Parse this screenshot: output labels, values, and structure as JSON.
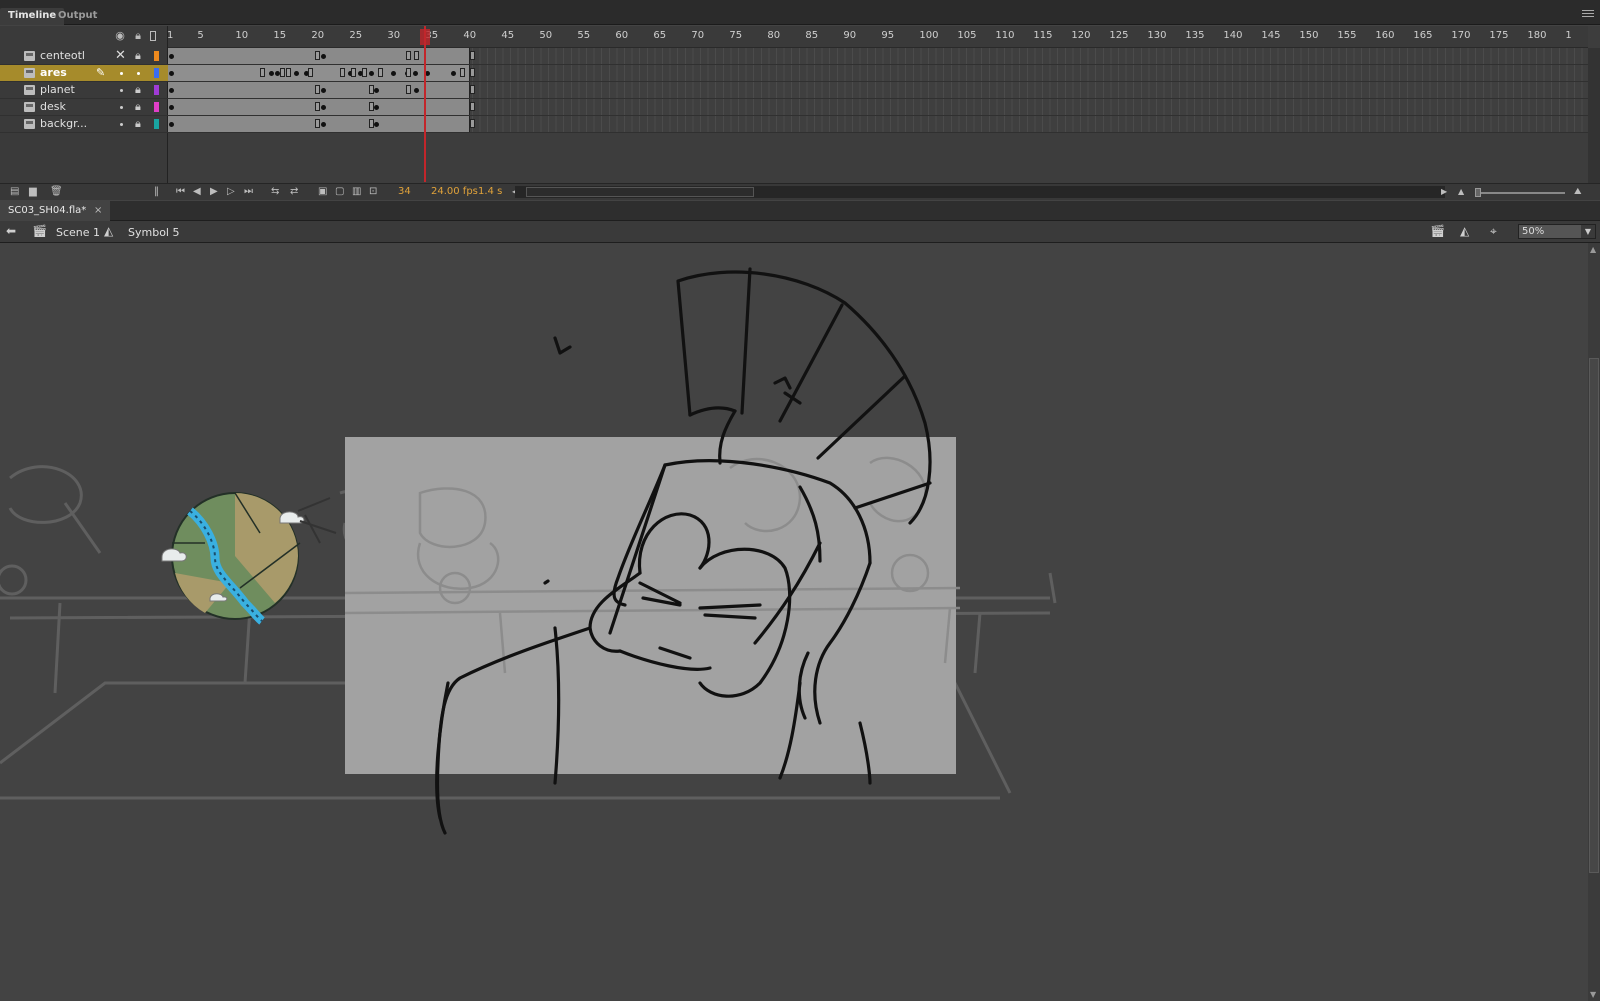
{
  "panel_tabs": [
    "Timeline",
    "Output"
  ],
  "ruler_ticks": [
    "1",
    "5",
    "10",
    "15",
    "20",
    "25",
    "30",
    "35",
    "40",
    "45",
    "50",
    "55",
    "60",
    "65",
    "70",
    "75",
    "80",
    "85",
    "90",
    "95",
    "100",
    "105",
    "110",
    "115",
    "120",
    "125",
    "130",
    "135",
    "140",
    "145",
    "150",
    "155",
    "160",
    "165",
    "170",
    "175",
    "180",
    "1"
  ],
  "layers": [
    {
      "name": "centeotl",
      "color": "#ee8a1e",
      "selected": false
    },
    {
      "name": "ares",
      "color": "#3a6df0",
      "selected": true
    },
    {
      "name": "planet",
      "color": "#a03bd6",
      "selected": false
    },
    {
      "name": "desk",
      "color": "#e03fc8",
      "selected": false
    },
    {
      "name": "backgr...",
      "color": "#19a4a0",
      "selected": false
    }
  ],
  "timeline_footer": {
    "current_frame": "34",
    "fps": "24.00 fps",
    "time": "1.4 s"
  },
  "document": {
    "tab_title": "SC03_SH04.fla*",
    "close": "×"
  },
  "edit_bar": {
    "scene": "Scene 1",
    "symbol": "Symbol 5",
    "zoom": "50%"
  },
  "icons": {
    "eye": "eye-icon",
    "lock": "lock-icon",
    "outline": "outline-icon",
    "pencil": "pencil-icon",
    "scene": "clapperboard-icon",
    "symbol": "symbol-icon"
  }
}
